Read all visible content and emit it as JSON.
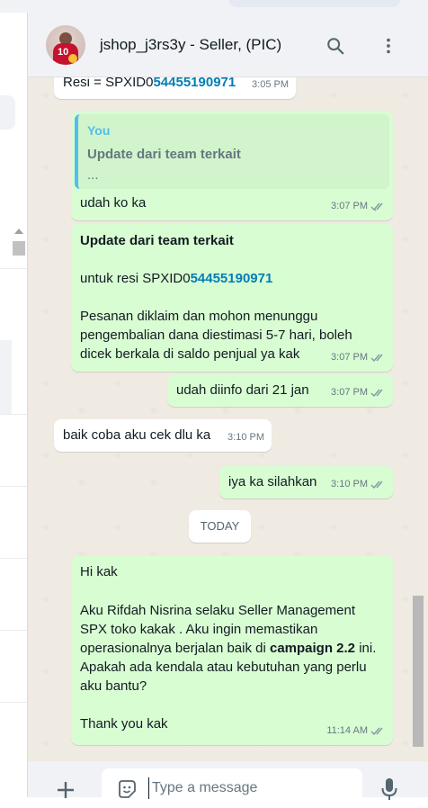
{
  "header": {
    "title": "jshop_j3rs3y   -   Seller, (PIC)",
    "icons": [
      "avatar",
      "search-icon",
      "more-vertical-icon"
    ]
  },
  "colors": {
    "outgoing_bubble": "#d9fdd3",
    "incoming_bubble": "#ffffff",
    "chat_background": "#efeae2",
    "link": "#027eb5",
    "quote_accent": "#53bdeb",
    "read_tick": "#8696a0"
  },
  "messages": [
    {
      "id": "m0",
      "direction": "in",
      "text_prefix": "Resi = SPXID0",
      "text_link": "54455190971",
      "time": "3:05 PM"
    },
    {
      "id": "m1",
      "direction": "out",
      "quote_author": "You",
      "quote_title": "Update dari team terkait",
      "quote_ellipsis": "...",
      "text": "udah ko ka",
      "time": "3:07 PM",
      "status": "read"
    },
    {
      "id": "m2",
      "direction": "out",
      "title": "Update dari team terkait",
      "resi_prefix": "untuk resi SPXID0",
      "resi_link": "54455190971",
      "body": "Pesanan diklaim dan mohon menunggu pengembalian dana diestimasi 5-7 hari, boleh dicek berkala di saldo penjual ya kak",
      "time": "3:07 PM",
      "status": "read"
    },
    {
      "id": "m3",
      "direction": "out",
      "text": "udah diinfo dari 21 jan",
      "time": "3:07 PM",
      "status": "read"
    },
    {
      "id": "m4",
      "direction": "in",
      "text": "baik coba aku cek dlu ka",
      "time": "3:10 PM"
    },
    {
      "id": "m5",
      "direction": "out",
      "text": "iya ka silahkan",
      "time": "3:10 PM",
      "status": "read"
    },
    {
      "id": "m6",
      "direction": "out",
      "greeting": "Hi kak",
      "body_before": "Aku Rifdah Nisrina selaku Seller Management SPX toko kakak . Aku ingin memastikan operasionalnya berjalan baik di ",
      "body_bold": "campaign 2.2",
      "body_after": " ini. Apakah ada kendala atau kebutuhan yang perlu aku bantu?",
      "signoff": "Thank you kak",
      "time": "11:14 AM",
      "status": "read"
    }
  ],
  "date_divider": "TODAY",
  "composer": {
    "placeholder": "Type a message",
    "icons": [
      "plus-icon",
      "emoji-icon",
      "mic-icon"
    ]
  }
}
